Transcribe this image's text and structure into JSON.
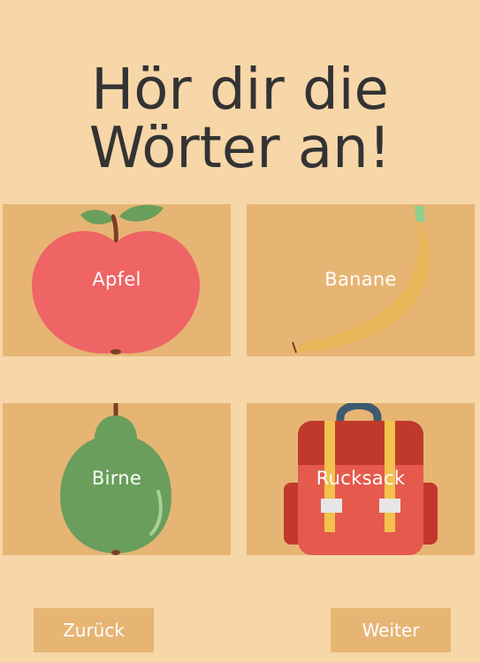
{
  "title": {
    "line1": "Hör dir die",
    "line2": "Wörter an!"
  },
  "cards": [
    {
      "label": "Apfel",
      "icon": "apple-icon"
    },
    {
      "label": "Banane",
      "icon": "banana-icon"
    },
    {
      "label": "Birne",
      "icon": "pear-icon"
    },
    {
      "label": "Rucksack",
      "icon": "backpack-icon"
    }
  ],
  "navigation": {
    "back_label": "Zurück",
    "next_label": "Weiter"
  },
  "colors": {
    "background": "#f7d6a8",
    "card": "#e6b574",
    "text": "#333333",
    "label": "#ffffff"
  }
}
